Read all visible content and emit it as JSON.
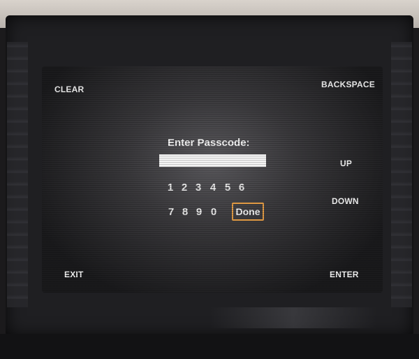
{
  "keypad": {
    "title": "Enter Passcode:",
    "passcode_value": "",
    "digits_row1": [
      "1",
      "2",
      "3",
      "4",
      "5",
      "6"
    ],
    "digits_row2": [
      "7",
      "8",
      "9",
      "0"
    ],
    "done_label": "Done"
  },
  "side_buttons": {
    "clear": "CLEAR",
    "backspace": "BACKSPACE",
    "up": "UP",
    "down": "DOWN",
    "exit": "EXIT",
    "enter": "ENTER"
  },
  "colors": {
    "focus_border": "#e29b45",
    "text": "#f2f2f2",
    "input_bg": "#f4f4f4"
  }
}
